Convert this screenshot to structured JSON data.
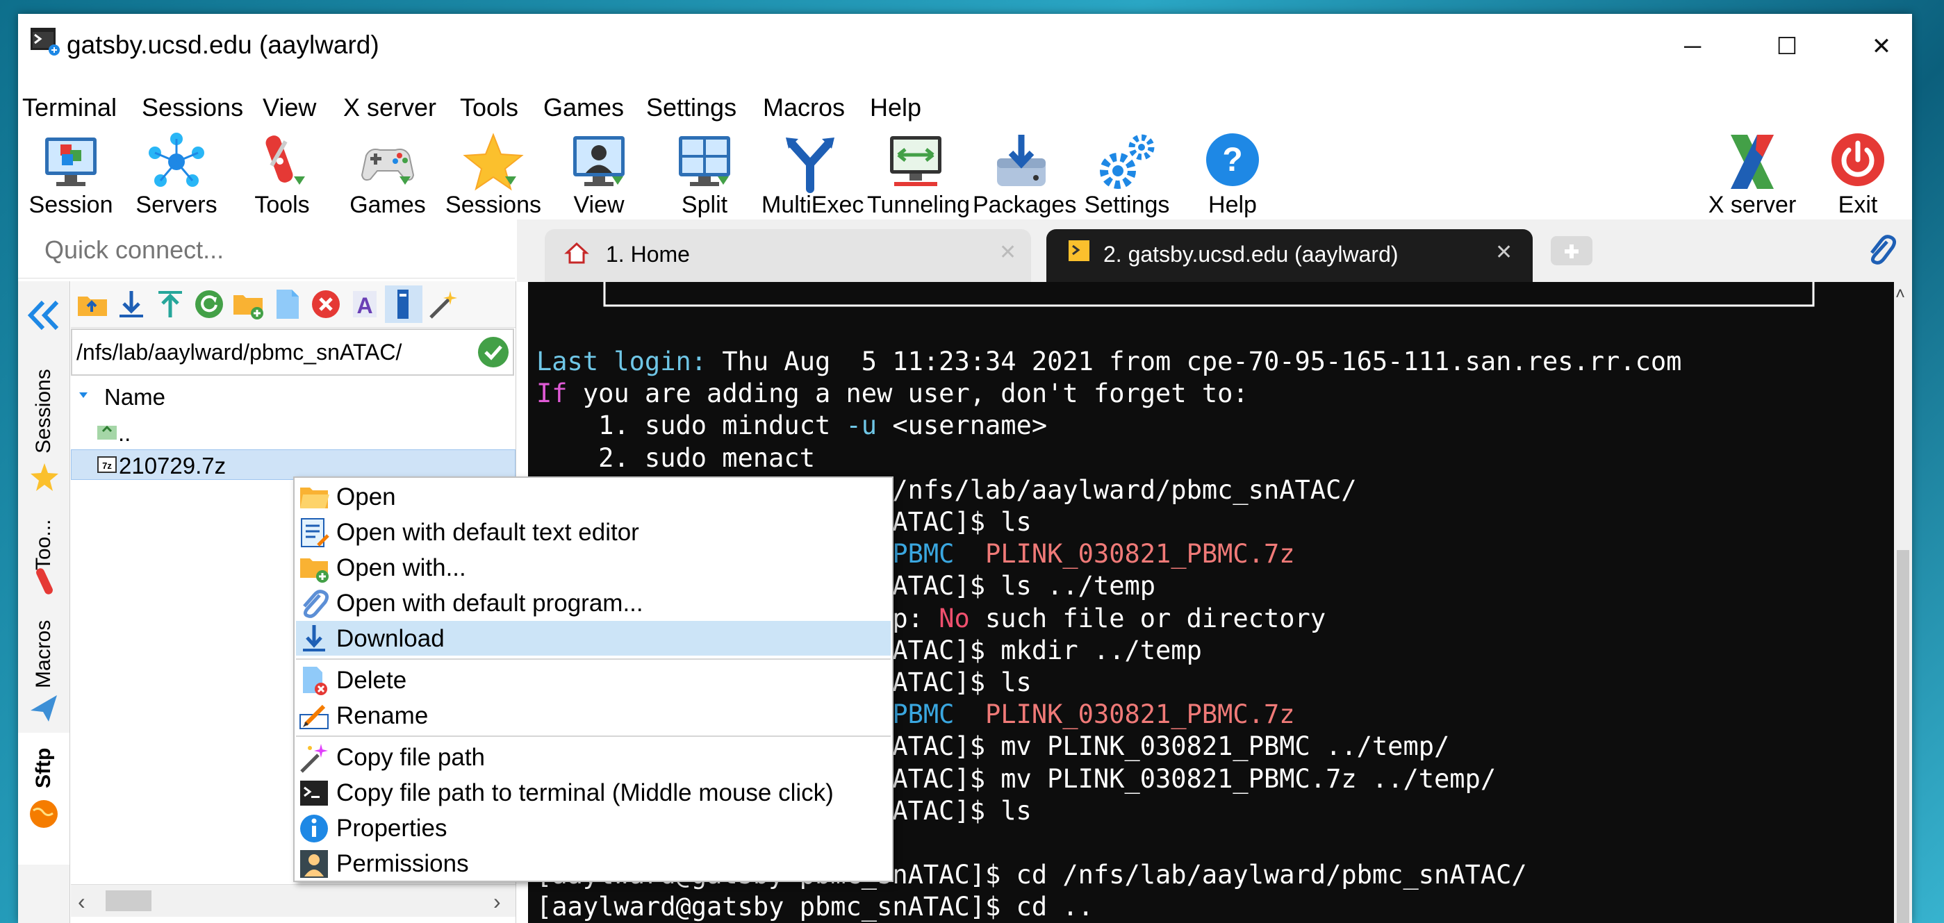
{
  "window": {
    "title": "gatsby.ucsd.edu (aaylward)",
    "controls": {
      "minimize": "─",
      "maximize": "☐",
      "close": "✕"
    }
  },
  "menu": [
    "Terminal",
    "Sessions",
    "View",
    "X server",
    "Tools",
    "Games",
    "Settings",
    "Macros",
    "Help"
  ],
  "toolbar": {
    "buttons": [
      "Session",
      "Servers",
      "Tools",
      "Games",
      "Sessions",
      "View",
      "Split",
      "MultiExec",
      "Tunneling",
      "Packages",
      "Settings",
      "Help"
    ],
    "right_buttons": [
      "X server",
      "Exit"
    ]
  },
  "quick_connect": {
    "placeholder": "Quick connect..."
  },
  "side_tabs": [
    "Sessions",
    "Too...",
    "Macros",
    "Sftp"
  ],
  "sftp": {
    "path": "/nfs/lab/aaylward/pbmc_snATAC/",
    "column_header": "Name",
    "rows": [
      "..",
      "210729.7z"
    ]
  },
  "tabs": [
    {
      "label": "1. Home"
    },
    {
      "label": "2. gatsby.ucsd.edu (aaylward)"
    }
  ],
  "terminal": {
    "lines": [
      [
        {
          "t": "Last login:",
          "c": "#6fc6e6"
        },
        {
          "t": " Thu Aug  5 11:23:34 2021 from cpe-70-95-165-111.san.res.rr.com",
          "c": "#ffffff"
        }
      ],
      [
        {
          "t": "If",
          "c": "#e05ad6"
        },
        {
          "t": " you are adding a new user, don't forget to:",
          "c": "#ffffff"
        }
      ],
      [
        {
          "t": "    1. sudo minduct ",
          "c": "#ffffff"
        },
        {
          "t": "-u",
          "c": "#6fc6e6"
        },
        {
          "t": " <username>",
          "c": "#ffffff"
        }
      ],
      [
        {
          "t": "    2. sudo menact",
          "c": "#ffffff"
        }
      ],
      [
        {
          "t": "                    cd /nfs/lab/aaylward/pbmc_snATAC/",
          "c": "#ffffff"
        }
      ],
      [
        {
          "t": "                   c_snATAC]$ ls",
          "c": "#ffffff"
        }
      ],
      [
        {
          "t": "                   321_PBMC  ",
          "c": "#3aa7e0"
        },
        {
          "t": "PLINK_030821_PBMC.7z",
          "c": "#f07a78"
        }
      ],
      [
        {
          "t": "                   c_snATAC]$ ls ../temp",
          "c": "#ffffff"
        }
      ],
      [
        {
          "t": "                   /temp: ",
          "c": "#ffffff"
        },
        {
          "t": "No",
          "c": "#f0506e"
        },
        {
          "t": " such file or directory",
          "c": "#ffffff"
        }
      ],
      [
        {
          "t": "                   c_snATAC]$ mkdir ../temp",
          "c": "#ffffff"
        }
      ],
      [
        {
          "t": "                   c_snATAC]$ ls",
          "c": "#ffffff"
        }
      ],
      [
        {
          "t": "                   321_PBMC  ",
          "c": "#3aa7e0"
        },
        {
          "t": "PLINK_030821_PBMC.7z",
          "c": "#f07a78"
        }
      ],
      [
        {
          "t": "                   c_snATAC]$ mv PLINK_030821_PBMC ../temp/",
          "c": "#ffffff"
        }
      ],
      [
        {
          "t": "                   c_snATAC]$ mv PLINK_030821_PBMC.7z ../temp/",
          "c": "#ffffff"
        }
      ],
      [
        {
          "t": "                   c_snATAC]$ ls",
          "c": "#ffffff"
        }
      ],
      [
        {
          "t": "",
          "c": "#ffffff"
        }
      ],
      [
        {
          "t": "[aaylward@gatsby pbmc_snATAC]$ cd /nfs/lab/aaylward/pbmc_snATAC/",
          "c": "#ffffff"
        }
      ],
      [
        {
          "t": "[aaylward@gatsby pbmc_snATAC]$ cd ..",
          "c": "#ffffff"
        }
      ]
    ]
  },
  "context_menu": {
    "items": [
      {
        "label": "Open",
        "icon": "folder-open-icon"
      },
      {
        "label": "Open with default text editor",
        "icon": "text-editor-icon"
      },
      {
        "label": "Open with...",
        "icon": "folder-add-icon"
      },
      {
        "label": "Open with default program...",
        "icon": "paperclip-icon"
      },
      {
        "label": "Download",
        "icon": "download-icon"
      },
      {
        "label": "Delete",
        "icon": "delete-icon"
      },
      {
        "label": "Rename",
        "icon": "rename-icon"
      },
      {
        "label": "Copy file path",
        "icon": "magic-wand-icon"
      },
      {
        "label": "Copy file path to terminal (Middle mouse click)",
        "icon": "terminal-icon"
      },
      {
        "label": "Properties",
        "icon": "info-icon"
      },
      {
        "label": "Permissions",
        "icon": "user-icon"
      }
    ],
    "highlighted": "Download"
  }
}
